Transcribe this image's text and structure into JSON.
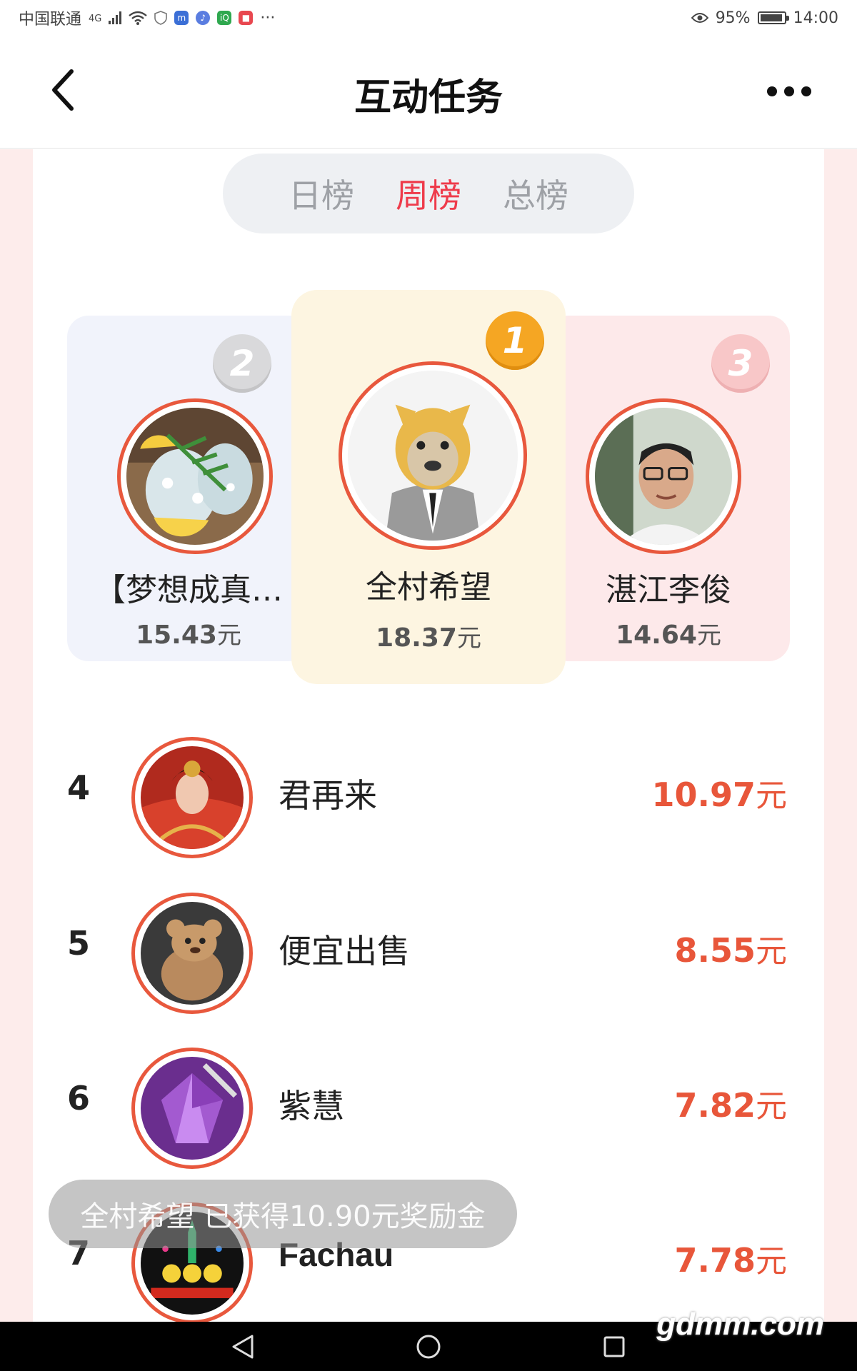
{
  "status_bar": {
    "carrier": "中国联通",
    "network": "4G",
    "battery": "95%",
    "time": "14:00",
    "overflow": "···"
  },
  "header": {
    "title": "互动任务",
    "back_icon": "chevron-left-icon",
    "more_icon": "more-dots-icon"
  },
  "tabs": [
    {
      "label": "日榜",
      "active": false
    },
    {
      "label": "周榜",
      "active": true
    },
    {
      "label": "总榜",
      "active": false
    }
  ],
  "podium": {
    "first": {
      "rank": "1",
      "name": "全村希望",
      "amount": "18.37",
      "unit": "元"
    },
    "second": {
      "rank": "2",
      "name": "【梦想成真…",
      "amount": "15.43",
      "unit": "元"
    },
    "third": {
      "rank": "3",
      "name": "湛江李俊",
      "amount": "14.64",
      "unit": "元"
    }
  },
  "list": [
    {
      "rank": "4",
      "name": "君再来",
      "amount": "10.97",
      "unit": "元"
    },
    {
      "rank": "5",
      "name": "便宜出售",
      "amount": "8.55",
      "unit": "元"
    },
    {
      "rank": "6",
      "name": "紫慧",
      "amount": "7.82",
      "unit": "元"
    },
    {
      "rank": "7",
      "name": "Fachau",
      "amount": "7.78",
      "unit": "元"
    }
  ],
  "toast": "全村希望  已获得10.90元奖励金",
  "watermark": "gdmm.com",
  "colors": {
    "accent_red": "#ee3b4b",
    "amount_orange": "#e8563a",
    "gold": "#f5a623",
    "ring": "#e8583d"
  }
}
